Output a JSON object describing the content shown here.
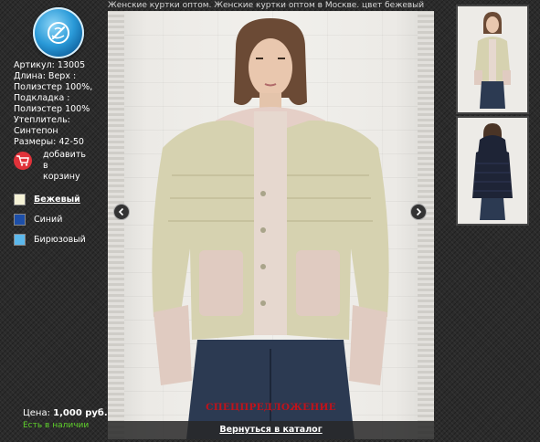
{
  "page": {
    "title": "Женские куртки оптом. Женские куртки оптом в Москве. цвет бежевый"
  },
  "product": {
    "article": "Артикул: 13005",
    "details": [
      "Длина: Верх :",
      "Полиэстер 100%,",
      "Подкладка :",
      "Полиэстер 100%",
      "Утеплитель:",
      "Синтепон",
      "Размеры: 42-50"
    ],
    "cart_label_lines": [
      "добавить",
      "в",
      "корзину"
    ],
    "colors": [
      {
        "label": "Бежевый",
        "hex": "#f5f2d6",
        "active": true
      },
      {
        "label": "Синий",
        "hex": "#1d4fa8",
        "active": false
      },
      {
        "label": "Бирюзовый",
        "hex": "#5cb8ec",
        "active": false
      }
    ],
    "price_label": "Цена:",
    "price_value": "1,000 руб.",
    "stock": "Есть в наличии"
  },
  "gallery": {
    "special_offer": "СПЕЦПРЕДЛОЖЕНИЕ",
    "back_link": "Вернуться в каталог",
    "main_photo": {
      "jacket_color": "#d6d2b0",
      "pocket_color": "#e0cbc1",
      "hood_color": "#e5cfc7",
      "jeans_color": "#2c3a52"
    },
    "thumbnails": [
      {
        "jacket_color": "#d6d2b0"
      },
      {
        "jacket_color": "#1e2436"
      }
    ]
  },
  "colors": {
    "stock_green": "#5fd12b",
    "special_red": "#c0131b",
    "cart_red": "#e0323a"
  }
}
